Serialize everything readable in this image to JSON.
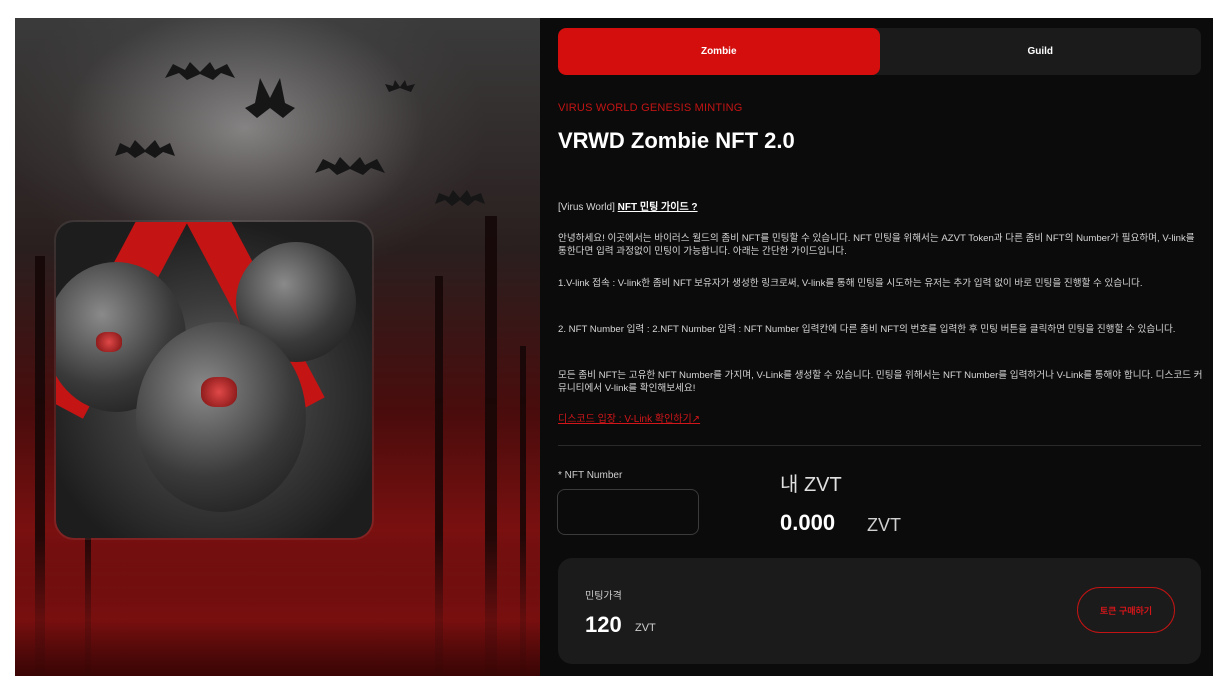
{
  "tabs": [
    {
      "label": "Zombie",
      "active": true
    },
    {
      "label": "Guild",
      "active": false
    }
  ],
  "header": {
    "eyebrow": "VIRUS WORLD GENESIS MINTING",
    "title": "VRWD Zombie NFT 2.0"
  },
  "guide": {
    "prefix": "[Virus World]",
    "link": "NFT 민팅 가이드 ?"
  },
  "paragraphs": [
    "안녕하세요! 이곳에서는 바이러스 월드의 좀비 NFT를 민팅할 수 있습니다. NFT 민팅을 위해서는 AZVT Token과 다른 좀비 NFT의 Number가 필요하며, V-link를 통한다면 입력 과정없이 민팅이 가능합니다. 아래는 간단한 가이드입니다.",
    "1.V-link 접속 : V-link한 좀비 NFT 보유자가 생성한 링크로써, V-link를 통해 민팅을 시도하는 유저는 추가 입력 없이 바로 민팅을 진행할 수 있습니다.",
    "2. NFT Number 입력 : 2.NFT Number 입력 : NFT Number 입력칸에 다른 좀비 NFT의 번호를 입력한 후 민팅 버튼을 클릭하면 민팅을 진행할 수 있습니다.",
    "모든 좀비 NFT는 고유한 NFT Number를 가지며, V-Link를 생성할 수 있습니다. 민팅을 위해서는 NFT Number를 입력하거나 V-Link를 통해야 합니다. 디스코드 커뮤니티에서 V-link를 확인해보세요!"
  ],
  "discord_link": "디스코드 입장 : V-Link 확인하기↗",
  "form": {
    "nft_label": "* NFT Number",
    "nft_value": "",
    "my_zvt_label": "내 ZVT",
    "my_zvt_amount": "0.000",
    "my_zvt_unit": "ZVT"
  },
  "price": {
    "label": "민팅가격",
    "value": "120",
    "unit": "ZVT",
    "buy_button": "토큰 구매하기"
  },
  "colors": {
    "accent": "#d40d0d",
    "background": "#0b0b0b",
    "panel": "#1b1b1b"
  },
  "icons": {
    "external_link": "arrow-up-right-icon"
  }
}
